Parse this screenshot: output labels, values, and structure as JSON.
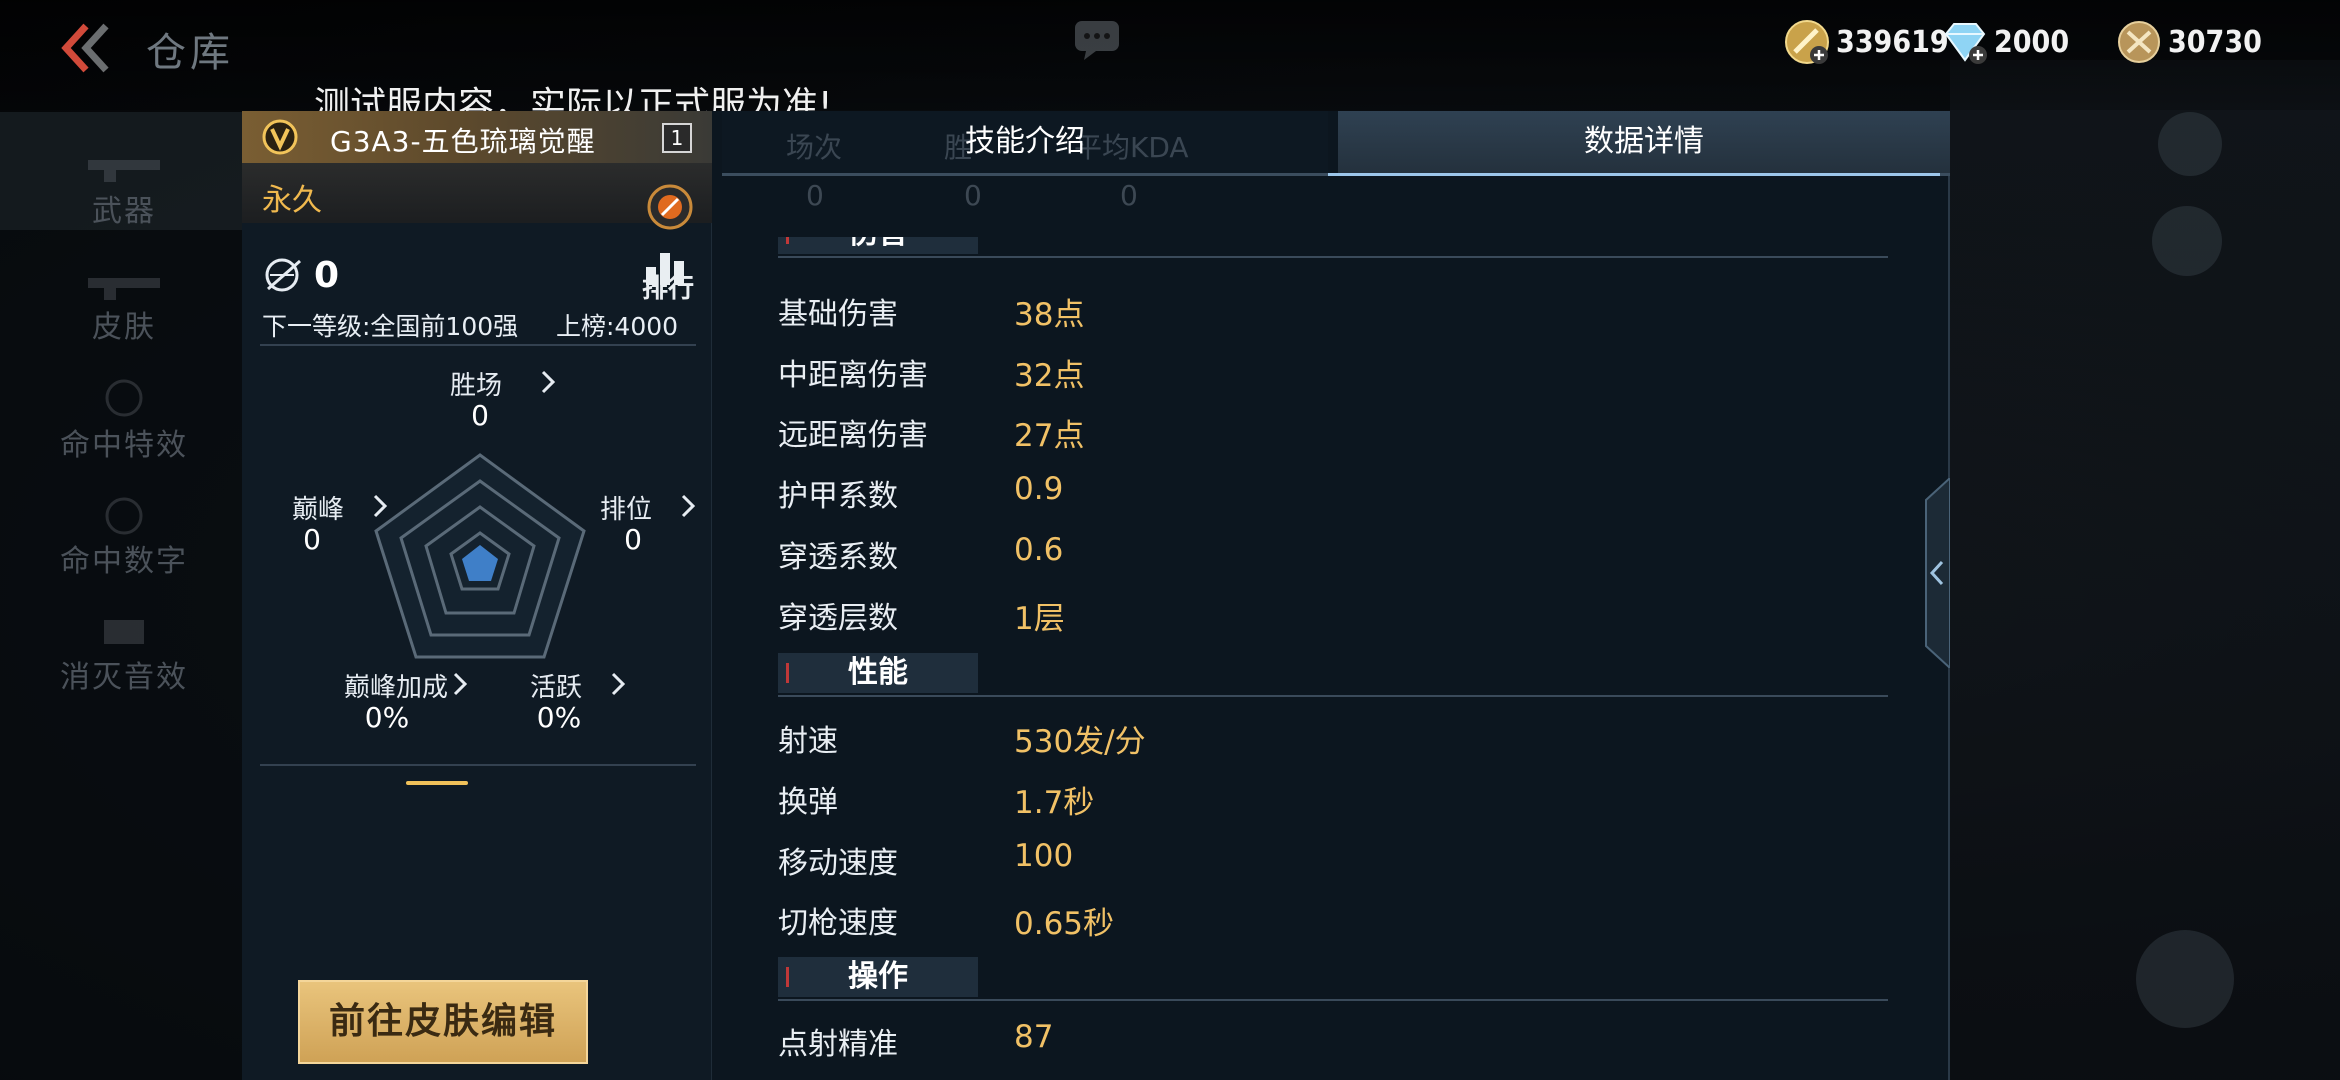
{
  "header": {
    "title": "仓库",
    "test_notice": "测试服内容，实际以正式服为准!"
  },
  "currencies": [
    {
      "icon": "gold-coin-add-icon",
      "value": "339619"
    },
    {
      "icon": "diamond-add-icon",
      "value": "2000"
    },
    {
      "icon": "honor-coin-icon",
      "value": "30730"
    }
  ],
  "left_nav": {
    "items": [
      {
        "label": "武器",
        "active": true
      },
      {
        "label": "皮肤",
        "active": false
      },
      {
        "label": "命中特效",
        "active": false
      },
      {
        "label": "命中数字",
        "active": false
      },
      {
        "label": "消灭音效",
        "active": false
      }
    ]
  },
  "weapon": {
    "name": "G3A3-五色琉璃觉醒",
    "level": "1",
    "duration": "永久",
    "kills": "0",
    "rank_label": "排行",
    "next_level": "下一等级:全国前100强",
    "on_board": "上榜:4000",
    "stats": {
      "wins": {
        "label": "胜场",
        "value": "0"
      },
      "peak": {
        "label": "巅峰",
        "value": "0"
      },
      "ranked": {
        "label": "排位",
        "value": "0"
      },
      "peak_bonus": {
        "label": "巅峰加成",
        "value": "0%"
      },
      "active": {
        "label": "活跃",
        "value": "0%"
      }
    },
    "skin_edit_button": "前往皮肤编辑"
  },
  "details": {
    "tabs": [
      {
        "label": "技能介绍",
        "active": false
      },
      {
        "label": "数据详情",
        "active": true
      }
    ],
    "ghost_headers": [
      "场次",
      "胜",
      "平均KDA"
    ],
    "ghost_values": [
      "0",
      "0",
      "0"
    ],
    "sections": [
      {
        "title": "伤害",
        "rows": [
          {
            "label": "基础伤害",
            "value": "38点"
          },
          {
            "label": "中距离伤害",
            "value": "32点"
          },
          {
            "label": "远距离伤害",
            "value": "27点"
          },
          {
            "label": "护甲系数",
            "value": "0.9"
          },
          {
            "label": "穿透系数",
            "value": "0.6"
          },
          {
            "label": "穿透层数",
            "value": "1层"
          }
        ]
      },
      {
        "title": "性能",
        "rows": [
          {
            "label": "射速",
            "value": "530发/分"
          },
          {
            "label": "换弹",
            "value": "1.7秒"
          },
          {
            "label": "移动速度",
            "value": "100"
          },
          {
            "label": "切枪速度",
            "value": "0.65秒"
          }
        ]
      },
      {
        "title": "操作",
        "rows": [
          {
            "label": "点射精准",
            "value": "87"
          }
        ]
      }
    ]
  },
  "colors": {
    "accent_gold": "#f1c166",
    "tab_active_line": "#9cc6ea",
    "section_tick": "#c03838"
  }
}
